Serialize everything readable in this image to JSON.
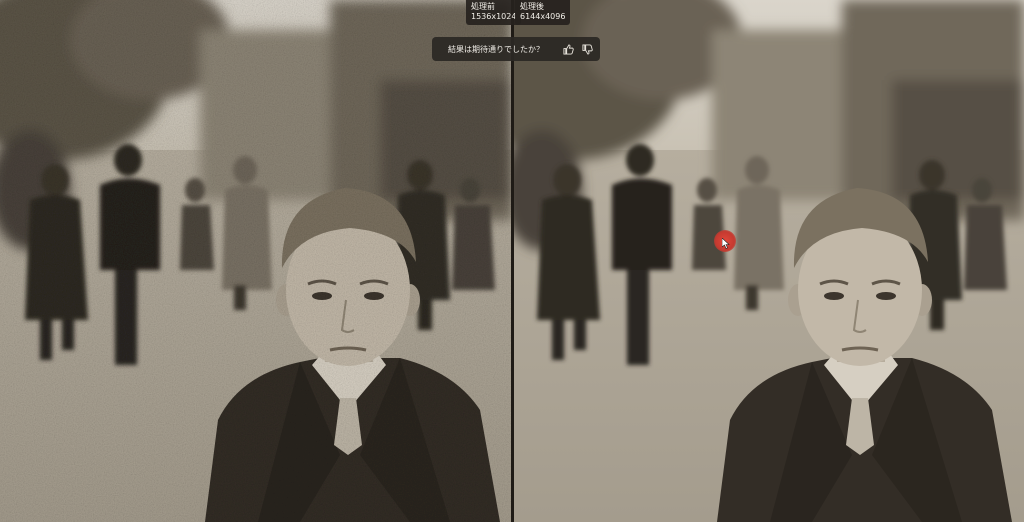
{
  "comparison": {
    "before": {
      "label": "処理前",
      "resolution": "1536x1024"
    },
    "after": {
      "label": "処理後",
      "resolution": "6144x4096"
    }
  },
  "feedback": {
    "question": "結果は期待通りでしたか？",
    "thumbs_up_icon": "thumbs-up-icon",
    "thumbs_down_icon": "thumbs-down-icon"
  },
  "colors": {
    "sepia_light": "#d8d1c2",
    "sepia_mid": "#a29a8c",
    "sepia_dark": "#3b342c",
    "coat": "#2f2a24",
    "overlay_bg": "#2c2824",
    "cursor_highlight": "#d2443a"
  }
}
